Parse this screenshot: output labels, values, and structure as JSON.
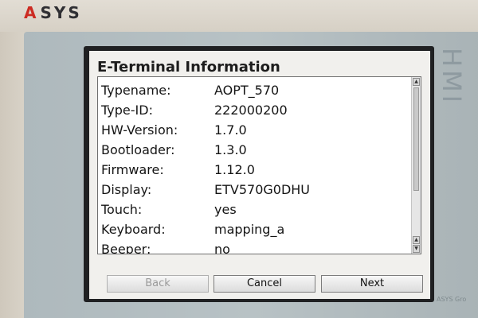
{
  "brand": {
    "logo_text_red": "A",
    "logo_text_dark": "SYS"
  },
  "bezel": {
    "side_label": "HMI",
    "footer_label": "ASYS Gro"
  },
  "window": {
    "title": "E-Terminal Information"
  },
  "info_rows": [
    {
      "label": "Typename:",
      "value": "AOPT_570"
    },
    {
      "label": "Type-ID:",
      "value": "222000200"
    },
    {
      "label": "HW-Version:",
      "value": "1.7.0"
    },
    {
      "label": "Bootloader:",
      "value": "1.3.0"
    },
    {
      "label": "Firmware:",
      "value": "1.12.0"
    },
    {
      "label": "Display:",
      "value": "ETV570G0DHU"
    },
    {
      "label": "Touch:",
      "value": "yes"
    },
    {
      "label": "Keyboard:",
      "value": "mapping_a"
    },
    {
      "label": "Beeper:",
      "value": "no"
    }
  ],
  "buttons": {
    "back": "Back",
    "cancel": "Cancel",
    "next": "Next"
  },
  "scrollbar": {
    "up_glyph": "▲",
    "down_glyph": "▼"
  },
  "colors": {
    "logo_red": "#cc2b22",
    "screen_bg": "#f1f0ed",
    "bezel": "#b8c2c5"
  }
}
